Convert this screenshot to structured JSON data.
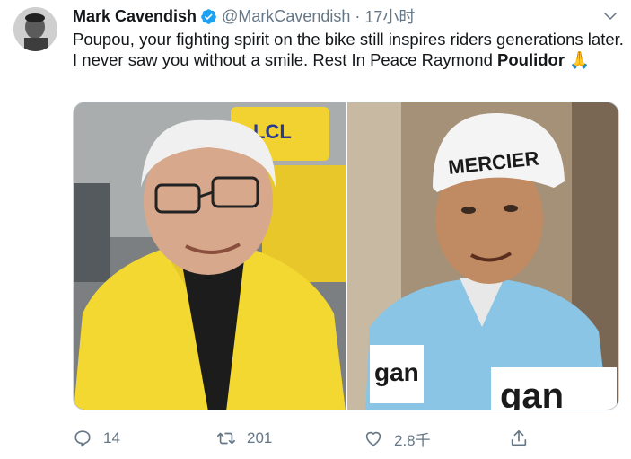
{
  "author": {
    "name": "Mark Cavendish",
    "handle": "@MarkCavendish",
    "separator": "·",
    "time": "17小时"
  },
  "tweet": {
    "text_plain": "Poupou, your fighting spirit on the bike still inspires riders generations later. I never saw you without a smile. Rest In Peace Raymond ",
    "text_bold": "Poulidor",
    "emoji": "🙏"
  },
  "media": {
    "left_photo_caps_text": "LCL",
    "right_photo_cap_text": "MERCIER",
    "right_photo_jersey_text": "gan"
  },
  "actions": {
    "reply_count": "14",
    "retweet_count": "201",
    "like_count": "2.8千",
    "share_label": ""
  },
  "colors": {
    "text_primary": "#14171a",
    "text_secondary": "#657786",
    "verified_blue": "#1da1f2"
  },
  "icons": {
    "verified": "verified-badge-icon",
    "caret": "chevron-down-icon",
    "reply": "reply-icon",
    "retweet": "retweet-icon",
    "like": "heart-icon",
    "share": "share-icon"
  }
}
